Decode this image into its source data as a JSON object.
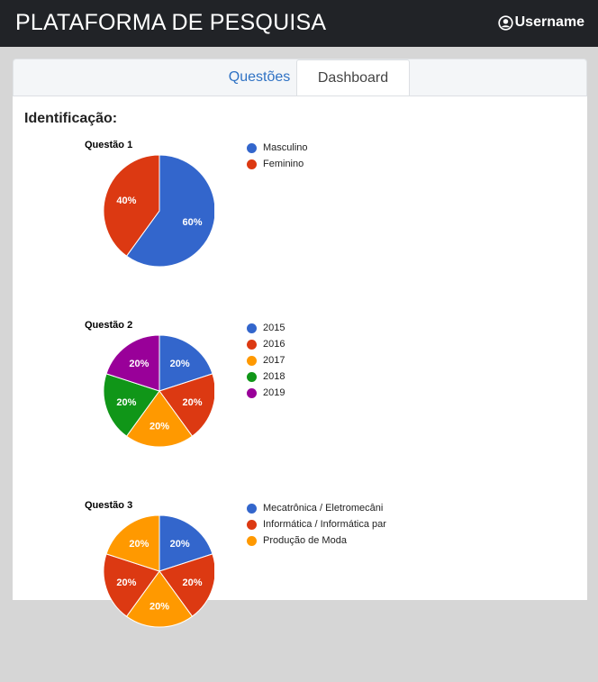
{
  "header": {
    "title": "PLATAFORMA DE PESQUISA",
    "username": "Username"
  },
  "tabs": [
    {
      "label": "Questões",
      "active": false
    },
    {
      "label": "Dashboard",
      "active": true
    }
  ],
  "section": {
    "title": "Identificação:"
  },
  "chart_data": [
    {
      "type": "pie",
      "title": "Questão 1",
      "categories": [
        "Masculino",
        "Feminino"
      ],
      "values": [
        60,
        40
      ],
      "labels": [
        "60%",
        "40%"
      ],
      "colors": [
        "#3366cc",
        "#dc3912"
      ],
      "legend": "right"
    },
    {
      "type": "pie",
      "title": "Questão 2",
      "categories": [
        "2015",
        "2016",
        "2017",
        "2018",
        "2019"
      ],
      "values": [
        20,
        20,
        20,
        20,
        20
      ],
      "labels": [
        "20%",
        "20%",
        "20%",
        "20%",
        "20%"
      ],
      "colors": [
        "#3366cc",
        "#dc3912",
        "#ff9900",
        "#109618",
        "#990099"
      ],
      "legend": "right"
    },
    {
      "type": "pie",
      "title": "Questão 3",
      "categories": [
        "Mecatrônica / Eletromecânica",
        "Informática / Informática para Internet",
        "Produção de Moda"
      ],
      "legend_text": [
        "Mecatrônica / Eletromecâni",
        "Informática / Informática par",
        "Produção de Moda"
      ],
      "values": [
        20,
        20,
        20,
        20,
        20
      ],
      "labels": [
        "20%",
        "20%",
        "20%",
        "20%",
        "20%"
      ],
      "colors": [
        "#3366cc",
        "#dc3912",
        "#ff9900",
        "#dc3912",
        "#ff9900"
      ],
      "legend": "right"
    }
  ]
}
